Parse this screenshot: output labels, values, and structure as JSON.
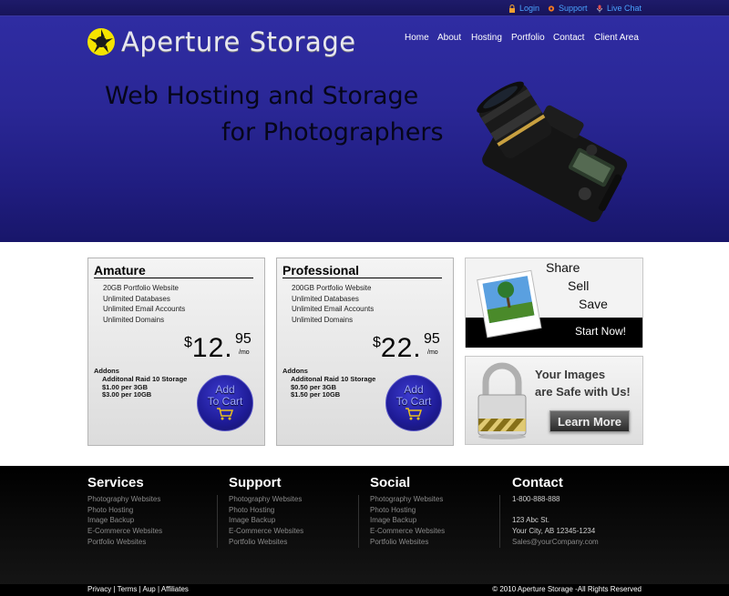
{
  "topbar": {
    "login": "Login",
    "support": "Support",
    "live_chat": "Live Chat"
  },
  "logo": {
    "text": "Aperture Storage"
  },
  "nav": [
    "Home",
    "About",
    "Hosting",
    "Portfolio",
    "Contact",
    "Client Area"
  ],
  "hero": {
    "line1": "Web Hosting and Storage",
    "line2": "for Photographers"
  },
  "plans": [
    {
      "title": "Amature",
      "features": [
        "20GB Portfolio Website",
        "Unlimited Databases",
        "Unlimited Email Accounts",
        "Unlimited Domains"
      ],
      "currency": "$",
      "price": "12.",
      "cents": "95",
      "period": "/mo",
      "addons_label": "Addons",
      "addon_name": "Additonal Raid 10 Storage",
      "addon_1": "$1.00 per 3GB",
      "addon_2": "$3.00 per 10GB",
      "cart_l1": "Add",
      "cart_l2": "To Cart"
    },
    {
      "title": "Professional",
      "features": [
        "200GB Portfolio Website",
        "Unlimited Databases",
        "Unlimited Email Accounts",
        "Unlimited Domains"
      ],
      "currency": "$",
      "price": "22.",
      "cents": "95",
      "period": "/mo",
      "addons_label": "Addons",
      "addon_name": "Additonal Raid 10 Storage",
      "addon_1": "$0.50 per 3GB",
      "addon_2": "$1.50 per 10GB",
      "cart_l1": "Add",
      "cart_l2": "To Cart"
    }
  ],
  "promo_share": {
    "share": "Share",
    "sell": "Sell",
    "save": "Save",
    "cta": "Start Now!"
  },
  "promo_secure": {
    "line1": "Your Images",
    "line2": "are Safe with Us!",
    "cta": "Learn More"
  },
  "footer": {
    "services": {
      "title": "Services",
      "items": [
        "Photography Websites",
        "Photo Hosting",
        "Image Backup",
        "E-Commerce Websites",
        "Portfolio Websites"
      ]
    },
    "support": {
      "title": "Support",
      "items": [
        "Photography Websites",
        "Photo Hosting",
        "Image Backup",
        "E-Commerce Websites",
        "Portfolio Websites"
      ]
    },
    "social": {
      "title": "Social",
      "items": [
        "Photography Websites",
        "Photo Hosting",
        "Image Backup",
        "E-Commerce Websites",
        "Portfolio Websites"
      ]
    },
    "contact": {
      "title": "Contact",
      "phone": "1-800-888-888",
      "street": "123 Abc St.",
      "city": "Your City, AB 12345-1234",
      "email": "Sales@yourCompany.com"
    }
  },
  "bottom": {
    "privacy": "Privacy",
    "terms": "Terms",
    "aup": "Aup",
    "affiliates": "Affiliates",
    "sep": "|",
    "copyright": "© 2010 Aperture Storage -All Rights Reserved"
  },
  "colors": {
    "header": "#2a2796",
    "link_blue": "#4aa3ff",
    "footer": "#000000"
  }
}
